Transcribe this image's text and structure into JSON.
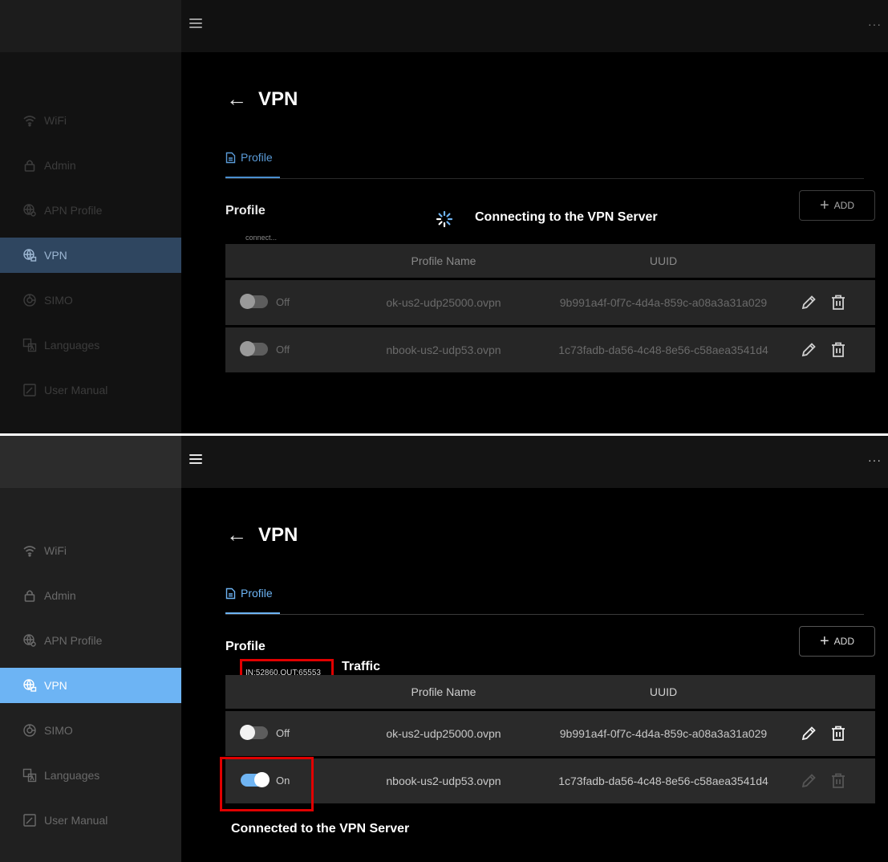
{
  "colors": {
    "background": "#000000",
    "accent_dim": "#2f4660",
    "accent": "#6db4f4",
    "annotation_box": "#e00000"
  },
  "top_panel": {
    "sidebar": [
      {
        "label": "WiFi",
        "icon": "wifi-icon"
      },
      {
        "label": "Admin",
        "icon": "lock-icon"
      },
      {
        "label": "APN Profile",
        "icon": "globe-gear-icon"
      },
      {
        "label": "VPN",
        "icon": "globe-lock-icon",
        "active": true
      },
      {
        "label": "SIMO",
        "icon": "simo-icon"
      },
      {
        "label": "Languages",
        "icon": "translate-icon"
      },
      {
        "label": "User Manual",
        "icon": "manual-icon"
      }
    ],
    "page_title": "VPN",
    "tab_label": "Profile",
    "section_title": "Profile",
    "status_text": "connect...",
    "add_label": "ADD",
    "annotation": "Connecting to the VPN Server",
    "table": {
      "headers": {
        "name": "Profile Name",
        "uuid": "UUID"
      },
      "rows": [
        {
          "state": "Off",
          "name": "ok-us2-udp25000.ovpn",
          "uuid": "9b991a4f-0f7c-4d4a-859c-a08a3a31a029"
        },
        {
          "state": "Off",
          "name": "nbook-us2-udp53.ovpn",
          "uuid": "1c73fadb-da56-4c48-8e56-c58aea3541d4"
        }
      ]
    }
  },
  "bottom_panel": {
    "sidebar": [
      {
        "label": "WiFi",
        "icon": "wifi-icon"
      },
      {
        "label": "Admin",
        "icon": "lock-icon"
      },
      {
        "label": "APN Profile",
        "icon": "globe-gear-icon"
      },
      {
        "label": "VPN",
        "icon": "globe-lock-icon",
        "active": true
      },
      {
        "label": "SIMO",
        "icon": "simo-icon"
      },
      {
        "label": "Languages",
        "icon": "translate-icon"
      },
      {
        "label": "User Manual",
        "icon": "manual-icon"
      }
    ],
    "page_title": "VPN",
    "tab_label": "Profile",
    "section_title": "Profile",
    "traffic_text": "IN:52860,OUT:65553",
    "traffic_annotation": "Traffic",
    "add_label": "ADD",
    "annotation": "Connected to the VPN Server",
    "table": {
      "headers": {
        "name": "Profile Name",
        "uuid": "UUID"
      },
      "rows": [
        {
          "state": "Off",
          "name": "ok-us2-udp25000.ovpn",
          "uuid": "9b991a4f-0f7c-4d4a-859c-a08a3a31a029"
        },
        {
          "state": "On",
          "name": "nbook-us2-udp53.ovpn",
          "uuid": "1c73fadb-da56-4c48-8e56-c58aea3541d4"
        }
      ]
    }
  }
}
